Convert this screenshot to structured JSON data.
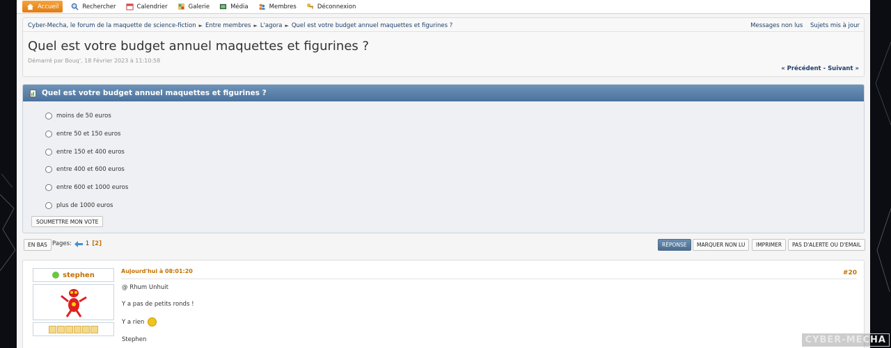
{
  "menu": [
    {
      "label": "Accueil",
      "icon": "home-icon",
      "active": true
    },
    {
      "label": "Rechercher",
      "icon": "search-icon"
    },
    {
      "label": "Calendrier",
      "icon": "calendar-icon"
    },
    {
      "label": "Galerie",
      "icon": "gallery-icon"
    },
    {
      "label": "Média",
      "icon": "media-icon"
    },
    {
      "label": "Membres",
      "icon": "members-icon"
    },
    {
      "label": "Déconnexion",
      "icon": "logout-icon"
    }
  ],
  "breadcrumb": {
    "items": [
      "Cyber-Mecha, le forum de la maquette de science-fiction",
      "Entre membres",
      "L'agora",
      "Quel est votre budget annuel maquettes et figurines ?"
    ],
    "separator": "►",
    "unread": "Messages non lus",
    "updated": "Sujets mis à jour"
  },
  "topic": {
    "title": "Quel est votre budget annuel maquettes et figurines ?",
    "started": "Démarré par Bouq', 18 Février 2023 à 11:10:58",
    "prev": "« Précédent",
    "sep": "-",
    "next": "Suivant »"
  },
  "poll": {
    "title": "Quel est votre budget annuel maquettes et figurines ?",
    "options": [
      "moins de 50 euros",
      "entre 50 et 150 euros",
      "entre 150 et 400 euros",
      "entre 400 et 600 euros",
      "entre 600 et 1000 euros",
      "plus de 1000 euros"
    ],
    "submit": "SOUMETTRE MON VOTE"
  },
  "pagination": {
    "down": "EN BAS",
    "label": "Pages:",
    "page1": "1",
    "current": "[2]"
  },
  "actions": {
    "reply": "RÉPONSE",
    "mark_unread": "MARQUER NON LU",
    "print": "IMPRIMER",
    "no_alert": "PAS D'ALERTE OU D'EMAIL"
  },
  "post": {
    "author": "stephen",
    "date": "Aujourd'hui à 08:01:20",
    "number": "#20",
    "lines": [
      "@ Rhum Unhuit",
      "Y a pas de petits ronds !",
      "Y a rien",
      "Stephen"
    ]
  },
  "watermark": "CYBER-MECHA",
  "colors": {
    "accent": "#e07d10",
    "link": "#1d3f6a",
    "header": "#4a729c"
  }
}
